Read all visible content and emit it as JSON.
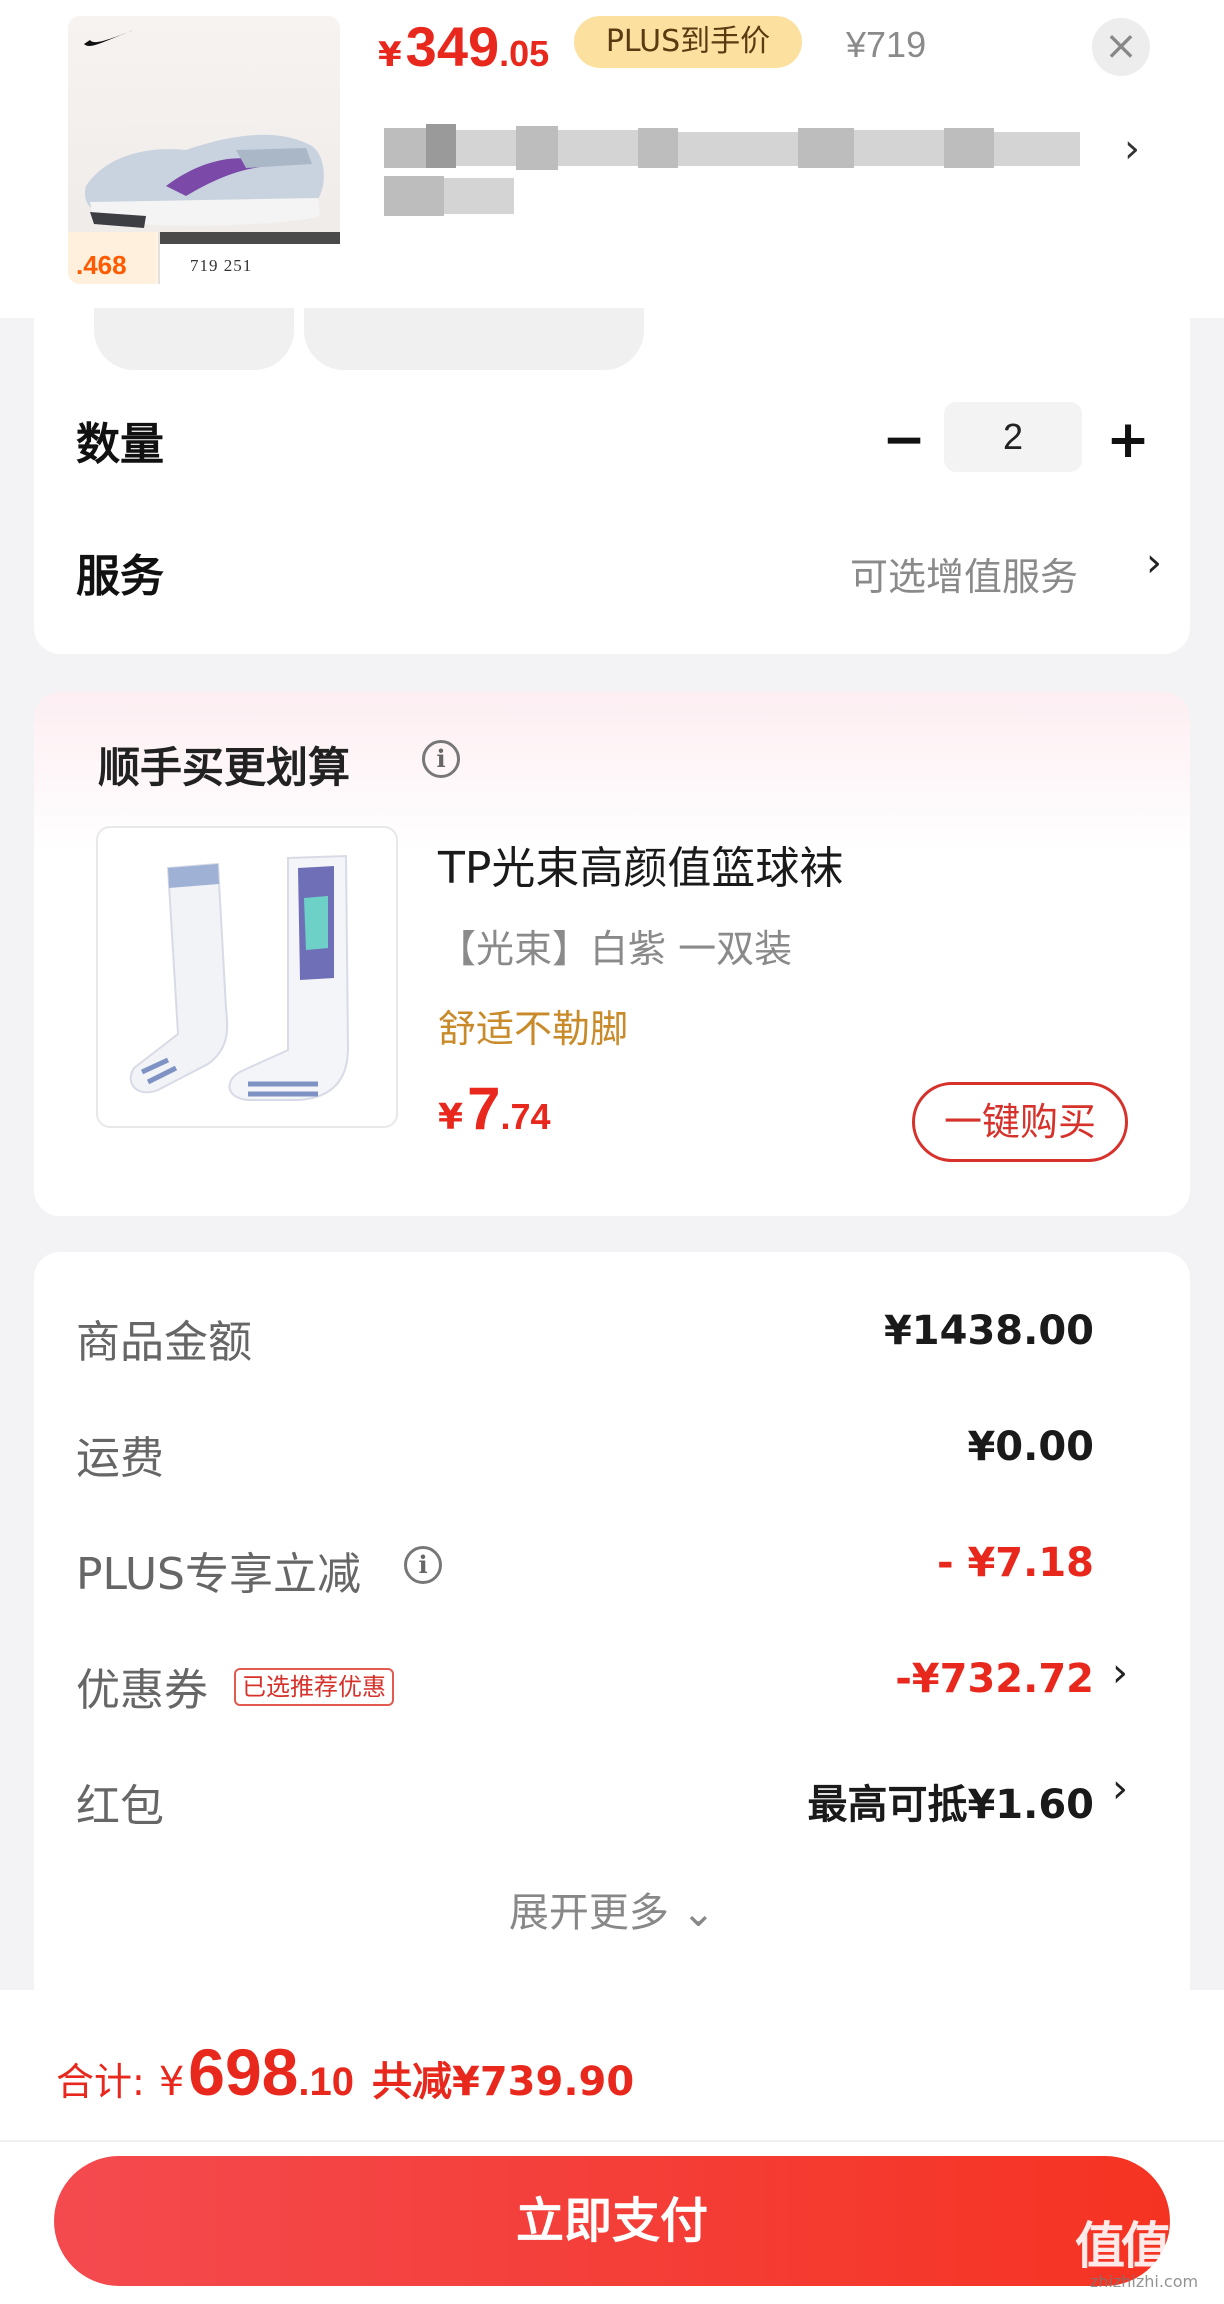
{
  "header": {
    "price_yen": "¥",
    "price_int": "349",
    "price_dec": ".05",
    "plus_badge": "PLUS到手价",
    "original_price": "¥719",
    "close_symbol": "×",
    "thumb_strip_price": ".468",
    "thumb_strip_nums": "719   251",
    "chevron": "›"
  },
  "quantity": {
    "label": "数量",
    "minus": "−",
    "value": "2",
    "plus": "+"
  },
  "service": {
    "label": "服务",
    "value": "可选增值服务",
    "chevron": "›"
  },
  "addon": {
    "title": "顺手买更划算",
    "info": "i",
    "name": "TP光束高颜值篮球袜",
    "spec": "【光束】白紫 一双装",
    "tag": "舒适不勒脚",
    "price_yen": "¥",
    "price_int": "7",
    "price_dec": ".74",
    "buy_label": "一键购买"
  },
  "summary": {
    "goods_label": "商品金额",
    "goods_value": "¥1438.00",
    "shipping_label": "运费",
    "shipping_value": "¥0.00",
    "plus_discount_label": "PLUS专享立减",
    "plus_discount_value": "- ¥7.18",
    "coupon_label": "优惠券",
    "coupon_badge": "已选推荐优惠",
    "coupon_value": "-¥732.72",
    "redpacket_label": "红包",
    "redpacket_value": "最高可抵¥1.60",
    "chevron": "›",
    "expand_label": "展开更多 ⌄"
  },
  "footer": {
    "total_label": "合计:",
    "total_yen": "¥",
    "total_int": "698",
    "total_dec": ".10",
    "total_saved": "共减¥739.90",
    "pay_label": "立即支付"
  },
  "watermark": {
    "big": "值值值",
    "small": "zhizhizhi.com"
  },
  "colors": {
    "accent_red": "#e8281c",
    "plus_gold": "#fbe0a0",
    "tag_orange": "#c98a2a"
  }
}
